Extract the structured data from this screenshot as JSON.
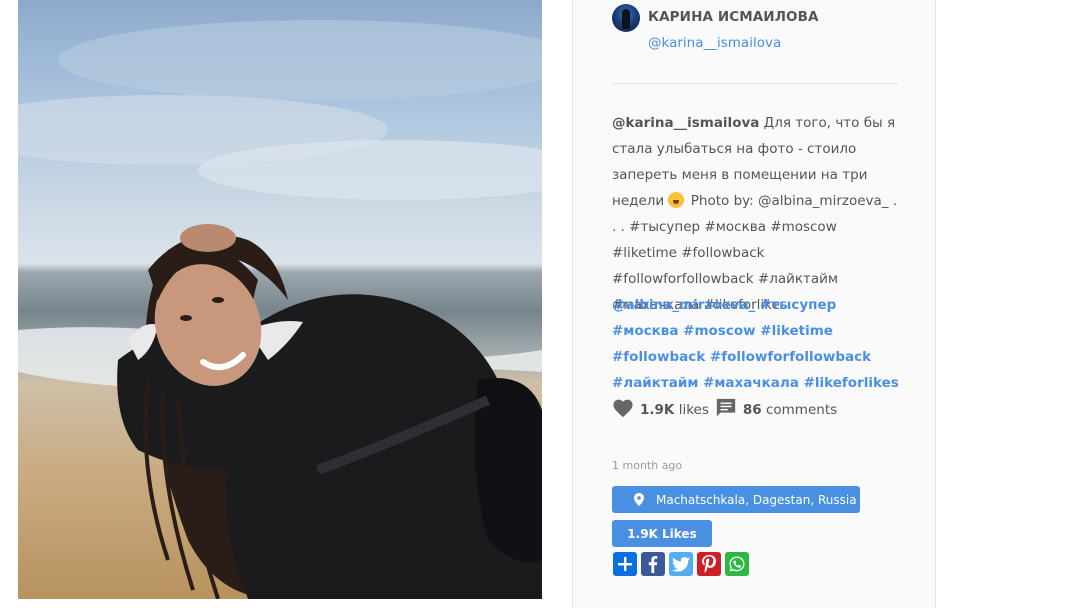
{
  "post": {
    "image": {
      "subject": "photo-of-smiling-woman-on-beach"
    },
    "author": {
      "name": "КАРИНА ИСМАИЛОВА",
      "handle": "@karina__ismailova"
    },
    "caption": {
      "mention": "@karina__ismailova",
      "line1": " Для того, что бы я стала улыбаться на фото - стоило запереть меня в помещении на три недели",
      "line2": " Photo by: @albina_mirzoeva_ . . . #тысупер #москва #moscow #liketime #followback #followforfollowback #лайктайм #махачкала #likeforlikes"
    },
    "tags": [
      "@albina_mirzoeva_",
      "#тысупер",
      "#москва",
      "#moscow",
      "#liketime",
      "#followback",
      "#followforfollowback",
      "#лайктайм",
      "#махачкала",
      "#likeforlikes"
    ],
    "stats": {
      "likes_count": "1.9K",
      "likes_label": "likes",
      "comments_count": "86",
      "comments_label": "comments"
    },
    "time_ago": "1 month ago",
    "location_button": "Machatschkala, Dagestan, Russia",
    "likes_button": "1.9K Likes",
    "share_icons": [
      "share-plus-icon",
      "facebook-icon",
      "twitter-icon",
      "pinterest-icon",
      "whatsapp-icon"
    ]
  },
  "colors": {
    "accent": "#4a90e2",
    "text": "#555555",
    "muted": "#999999",
    "card_bg": "#fafafa",
    "share_plus": "#0b6fe0",
    "facebook": "#3b5998",
    "twitter": "#55acee",
    "pinterest": "#cb2027",
    "whatsapp": "#2cb742"
  }
}
